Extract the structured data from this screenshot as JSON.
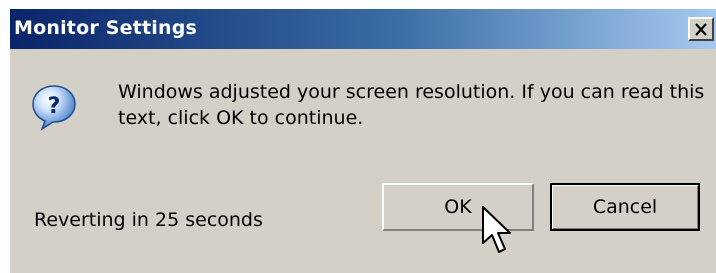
{
  "window": {
    "title": "Monitor Settings",
    "close_glyph": "x"
  },
  "icon": "question-icon",
  "message": "Windows adjusted your screen resolution. If you can read this text, click OK to continue.",
  "status": "Reverting in 25 seconds",
  "buttons": {
    "ok": "OK",
    "cancel": "Cancel"
  },
  "colors": {
    "titlebar_start": "#0a246a",
    "titlebar_end": "#a6caf0",
    "dialog_face": "#d4d0c8"
  }
}
